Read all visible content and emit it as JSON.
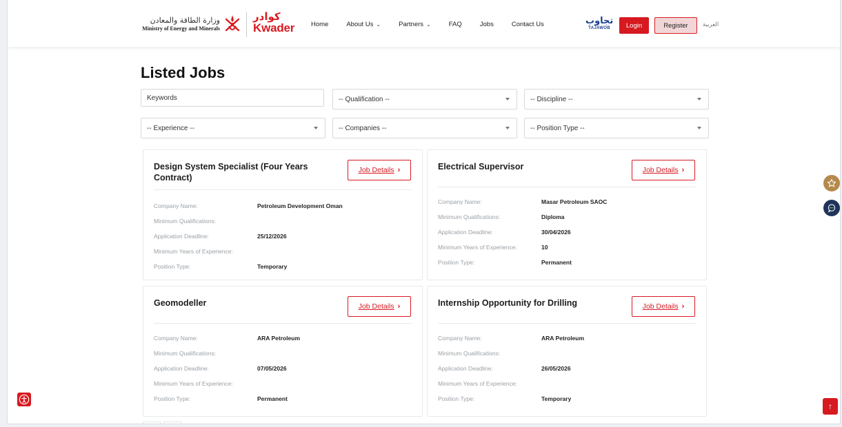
{
  "header": {
    "ministry_ar": "وزارة الطاقة والمعادن",
    "ministry_en": "Ministry of Energy and Minerals",
    "kwader_ar": "كوادر",
    "kwader_en": "Kwader",
    "nav": [
      {
        "label": "Home",
        "has_dropdown": false
      },
      {
        "label": "About Us",
        "has_dropdown": true
      },
      {
        "label": "Partners",
        "has_dropdown": true
      },
      {
        "label": "FAQ",
        "has_dropdown": false
      },
      {
        "label": "Jobs",
        "has_dropdown": false
      },
      {
        "label": "Contact Us",
        "has_dropdown": false
      }
    ],
    "tajawob_ar": "تجاوب",
    "tajawob_en": "TAJAWOB",
    "login_label": "Login",
    "register_label": "Register",
    "lang_label": "العربية"
  },
  "main": {
    "title": "Listed Jobs",
    "filters": {
      "keywords_placeholder": "Keywords",
      "qualification": "-- Qualification --",
      "discipline": "-- Discipline --",
      "experience": "-- Experience --",
      "companies": "-- Companies --",
      "position_type": "-- Position Type --"
    },
    "field_labels": {
      "company": "Company Name:",
      "qualifications": "Minimum Qualifications:",
      "deadline": "Application Deadline:",
      "experience": "Minimum Years of Experience:",
      "position_type": "Position Type:"
    },
    "details_label": "Job Details",
    "jobs": [
      {
        "title": "Design System Specialist (Four Years Contract)",
        "company": "Petroleum Development Oman",
        "qualifications": "",
        "deadline": "25/12/2026",
        "experience": "",
        "position_type": "Temporary"
      },
      {
        "title": "Electrical Supervisor",
        "company": "Masar Petroleum SAOC",
        "qualifications": "Diploma",
        "deadline": "30/04/2026",
        "experience": "10",
        "position_type": "Permanent"
      },
      {
        "title": "Geomodeller",
        "company": "ARA Petroleum",
        "qualifications": "",
        "deadline": "07/05/2026",
        "experience": "",
        "position_type": "Permanent"
      },
      {
        "title": "Internship Opportunity for Drilling",
        "company": "ARA Petroleum",
        "qualifications": "",
        "deadline": "26/05/2026",
        "experience": "",
        "position_type": "Temporary"
      }
    ]
  },
  "colors": {
    "brand_red": "#d71920",
    "tajawob_blue": "#1b3f8f",
    "star_gold": "#b5894d",
    "chat_navy": "#1e3558"
  },
  "icons": [
    "oman-emblem-icon",
    "chevron-down-icon",
    "chevron-right-icon",
    "star-icon",
    "chat-icon",
    "accessibility-icon",
    "arrow-up-icon"
  ]
}
